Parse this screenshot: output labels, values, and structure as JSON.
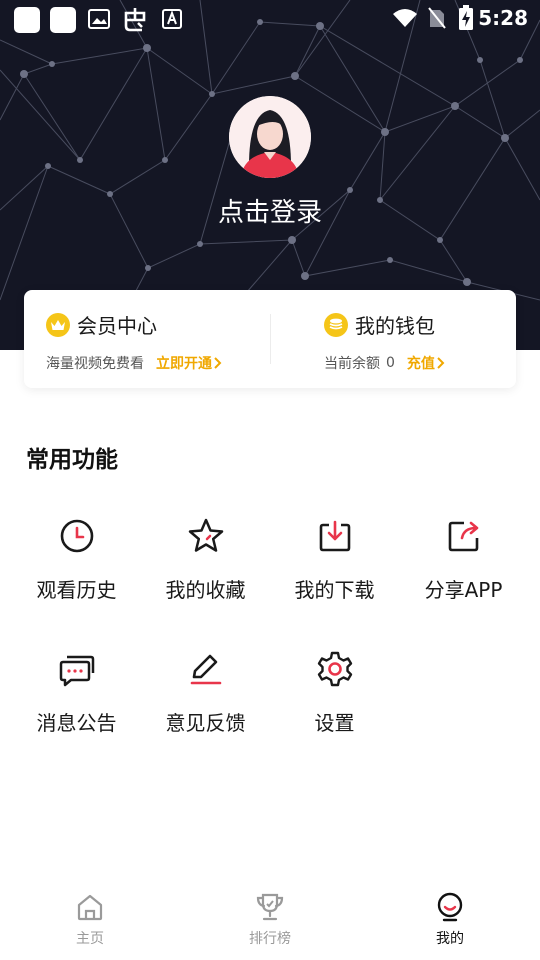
{
  "status_bar": {
    "time": "5:28"
  },
  "profile": {
    "login_label": "点击登录"
  },
  "vip": {
    "title": "会员中心",
    "subtitle": "海量视频免费看",
    "action": "立即开通"
  },
  "wallet": {
    "title": "我的钱包",
    "balance_label": "当前余额",
    "balance": "0",
    "action": "充值"
  },
  "features": {
    "title": "常用功能",
    "items": [
      {
        "label": "观看历史",
        "icon": "clock-icon"
      },
      {
        "label": "我的收藏",
        "icon": "star-icon"
      },
      {
        "label": "我的下载",
        "icon": "download-icon"
      },
      {
        "label": "分享APP",
        "icon": "share-icon"
      },
      {
        "label": "消息公告",
        "icon": "message-icon"
      },
      {
        "label": "意见反馈",
        "icon": "feedback-icon"
      },
      {
        "label": "设置",
        "icon": "gear-icon"
      }
    ]
  },
  "bottom_nav": {
    "items": [
      {
        "label": "主页",
        "icon": "home-icon"
      },
      {
        "label": "排行榜",
        "icon": "trophy-icon"
      },
      {
        "label": "我的",
        "icon": "profile-icon",
        "active": true
      }
    ]
  },
  "colors": {
    "accent": "#e8354a",
    "gold": "#f0a800",
    "header_bg": "#141624"
  }
}
